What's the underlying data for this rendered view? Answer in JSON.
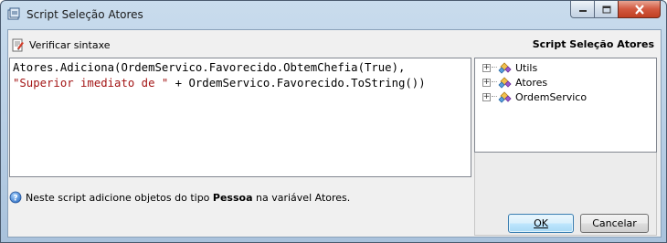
{
  "window": {
    "title": "Script Seleção Atores"
  },
  "toolbar": {
    "verify_label": "Verificar sintaxe"
  },
  "panel": {
    "title": "Script Seleção Atores"
  },
  "editor": {
    "line1": "Atores.Adiciona(OrdemServico.Favorecido.ObtemChefia(True),",
    "line2_string": "\"Superior imediato de \"",
    "line2_rest": " + OrdemServico.Favorecido.ToString())"
  },
  "tree": {
    "items": [
      {
        "label": "Utils",
        "expander": "+"
      },
      {
        "label": "Atores",
        "expander": "+"
      },
      {
        "label": "OrdemServico",
        "expander": "+"
      }
    ]
  },
  "info": {
    "text_before": "Neste script adicione objetos do tipo ",
    "text_bold": "Pessoa",
    "text_after": " na variável Atores."
  },
  "buttons": {
    "ok_label": "OK",
    "cancel_label": "Cancelar"
  },
  "colors": {
    "string_literal": "#a31515",
    "titlebar": "#b6cde4",
    "close_button": "#c03f22"
  }
}
